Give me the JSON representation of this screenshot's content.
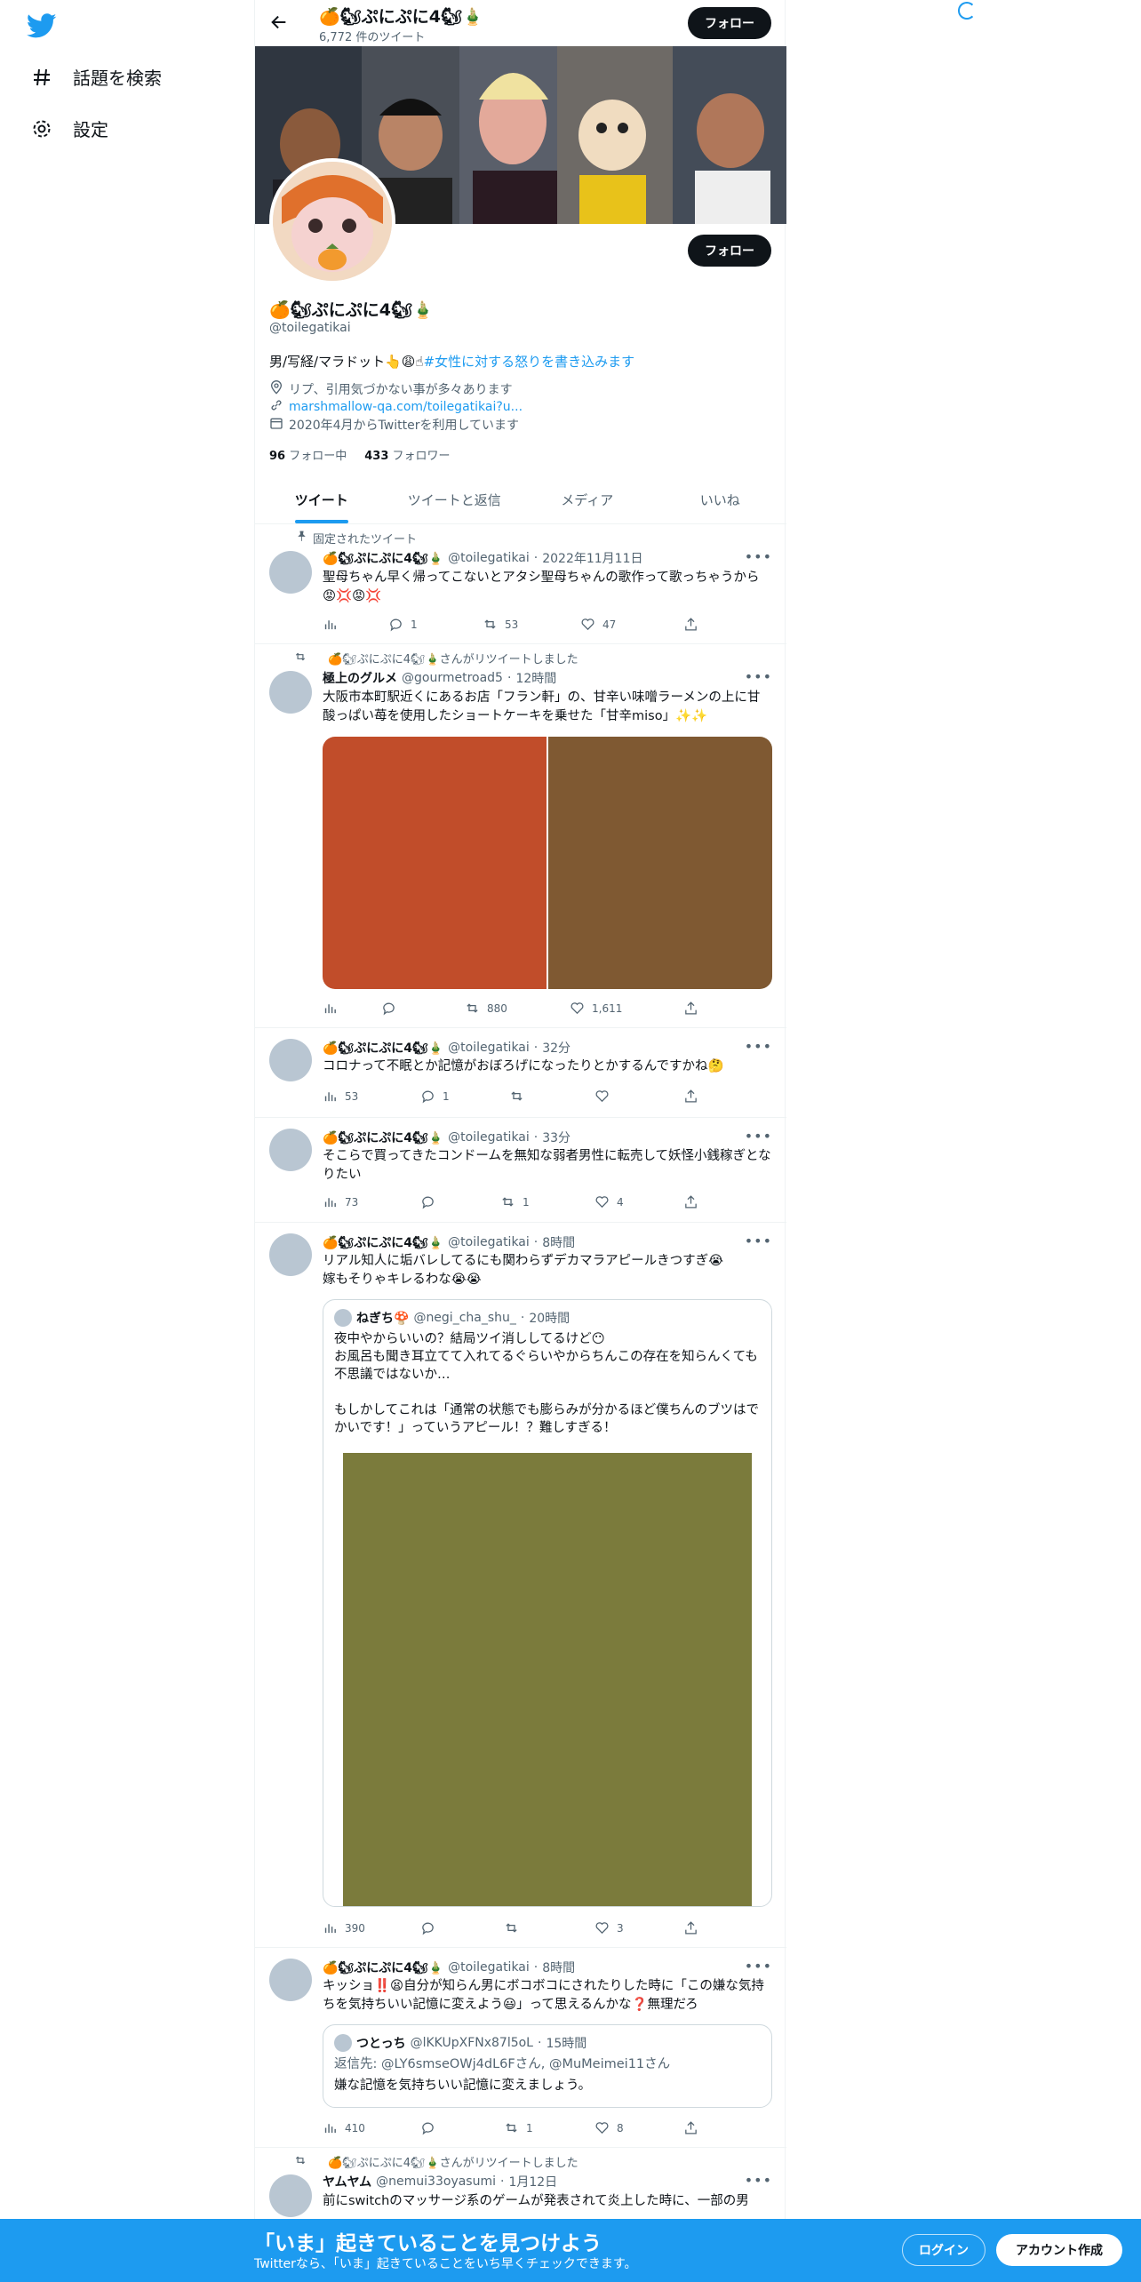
{
  "nav": {
    "explore_label": "話題を検索",
    "settings_label": "設定"
  },
  "profile": {
    "display_name": "🍊🐿ぷにぷに4🐿🎍",
    "tweet_count": "6,772 件のツイート",
    "follow_label": "フォロー",
    "handle": "@toilegatikai",
    "bio_text": "男/写経/マラドット👆😩☝",
    "bio_hashtag": "#女性に対する怒りを書き込みます",
    "location": "リプ、引用気づかない事が多々あります",
    "url": "marshmallow-qa.com/toilegatikai?u...",
    "joined": "2020年4月からTwitterを利用しています",
    "following_count": "96",
    "following_label": "フォロー中",
    "followers_count": "433",
    "followers_label": "フォロワー"
  },
  "tabs": [
    "ツイート",
    "ツイートと返信",
    "メディア",
    "いいね"
  ],
  "tweets": [
    {
      "context": "固定されたツイート",
      "name": "🍊🐿ぷにぷに4🐿🎍",
      "handle": "@toilegatikai",
      "time": "2022年11月11日",
      "text": "聖母ちゃん早く帰ってこないとアタシ聖母ちゃんの歌作って歌っちゃうから😡💢😡💢",
      "views": "",
      "replies": "1",
      "retweets": "53",
      "likes": "47"
    },
    {
      "context": "🍊🐿ぷにぷに4🐿🎍さんがリツイートしました",
      "name": "極上のグルメ",
      "handle": "@gourmetroad5",
      "time": "12時間",
      "text": "大阪市本町駅近くにあるお店「フラン軒」の、甘辛い味噌ラーメンの上に甘酸っぱい苺を使用したショートケーキを乗せた「甘辛miso」✨✨",
      "views": "",
      "replies": "",
      "retweets": "880",
      "likes": "1,611",
      "image_colors": [
        "#c14d2a",
        "#7f5932"
      ]
    },
    {
      "context": "",
      "name": "🍊🐿ぷにぷに4🐿🎍",
      "handle": "@toilegatikai",
      "time": "32分",
      "text": "コロナって不眠とか記憶がおぼろげになったりとかするんですかね🤔",
      "views": "53",
      "replies": "1",
      "retweets": "",
      "likes": ""
    },
    {
      "context": "",
      "name": "🍊🐿ぷにぷに4🐿🎍",
      "handle": "@toilegatikai",
      "time": "33分",
      "text": "そこらで買ってきたコンドームを無知な弱者男性に転売して妖怪小銭稼ぎとなりたい",
      "views": "73",
      "replies": "",
      "retweets": "1",
      "likes": "4"
    },
    {
      "context": "",
      "name": "🍊🐿ぷにぷに4🐿🎍",
      "handle": "@toilegatikai",
      "time": "8時間",
      "text": "リアル知人に垢バレしてるにも関わらずデカマラアピールきつすぎ😭\n嫁もそりゃキレるわな😭😭",
      "views": "390",
      "replies": "",
      "retweets": "",
      "likes": "3",
      "quote": {
        "name": "ねぎち🍄",
        "handle": "@negi_cha_shu_",
        "time": "20時間",
        "text": "夜中やからいいの？結局ツイ消ししてるけど😶\nお風呂も聞き耳立てて入れてるぐらいやからちんこの存在を知らんくても不思議ではないか…\n\nもしかしてこれは「通常の状態でも膨らみが分かるほど僕ちんのブツはでかいです！」っていうアピール！？難しすぎる！",
        "image_color": "#7b7b3c"
      }
    },
    {
      "context": "",
      "name": "🍊🐿ぷにぷに4🐿🎍",
      "handle": "@toilegatikai",
      "time": "8時間",
      "text": "キッショ‼️😫自分が知らん男にボコボコにされたりした時に「この嫌な気持ちを気持ちいい記憶に変えよう😃」って思えるんかな❓無理だろ",
      "views": "410",
      "replies": "",
      "retweets": "1",
      "likes": "8",
      "quote": {
        "name": "つとっち",
        "handle": "@lKKUpXFNx87l5oL",
        "time": "15時間",
        "reply_to": "返信先: @LY6smseOWj4dL6Fさん, @MuMeimei11さん",
        "text": "嫌な記憶を気持ちいい記憶に変えましょう。"
      }
    },
    {
      "context": "🍊🐿ぷにぷに4🐿🎍さんがリツイートしました",
      "name": "ヤムヤム",
      "handle": "@nemui33oyasumi",
      "time": "1月12日",
      "text": "前にswitchのマッサージ系のゲームが発表されて炎上した時に、一部の男"
    }
  ],
  "bottom_bar": {
    "title": "「いま」起きていることを見つけよう",
    "subtitle": "Twitterなら、「いま」起きていることをいち早くチェックできます。",
    "login_label": "ログイン",
    "signup_label": "アカウント作成"
  },
  "colors": {
    "accent": "#1d9bf0",
    "text_secondary": "#536471"
  }
}
